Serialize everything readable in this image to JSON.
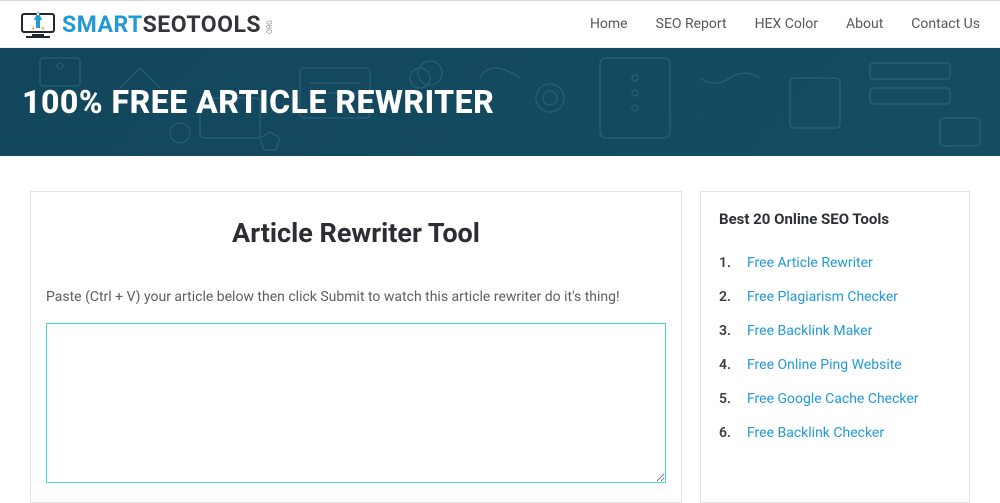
{
  "logo": {
    "smart": "SMART",
    "seo": "SEO",
    "tools": "TOOLS",
    "org": "ORG"
  },
  "nav": {
    "home": "Home",
    "report": "SEO Report",
    "hex": "HEX Color",
    "about": "About",
    "contact": "Contact Us"
  },
  "hero": {
    "title": "100% FREE ARTICLE REWRITER"
  },
  "main": {
    "title": "Article Rewriter Tool",
    "instruction": "Paste (Ctrl + V) your article below then click Submit to watch this article rewriter do it's thing!"
  },
  "sidebar": {
    "title": "Best 20 Online SEO Tools",
    "items": [
      {
        "num": "1.",
        "label": "Free Article Rewriter"
      },
      {
        "num": "2.",
        "label": "Free Plagiarism Checker"
      },
      {
        "num": "3.",
        "label": "Free Backlink Maker"
      },
      {
        "num": "4.",
        "label": "Free Online Ping Website"
      },
      {
        "num": "5.",
        "label": "Free Google Cache Checker"
      },
      {
        "num": "6.",
        "label": "Free Backlink Checker"
      }
    ]
  }
}
